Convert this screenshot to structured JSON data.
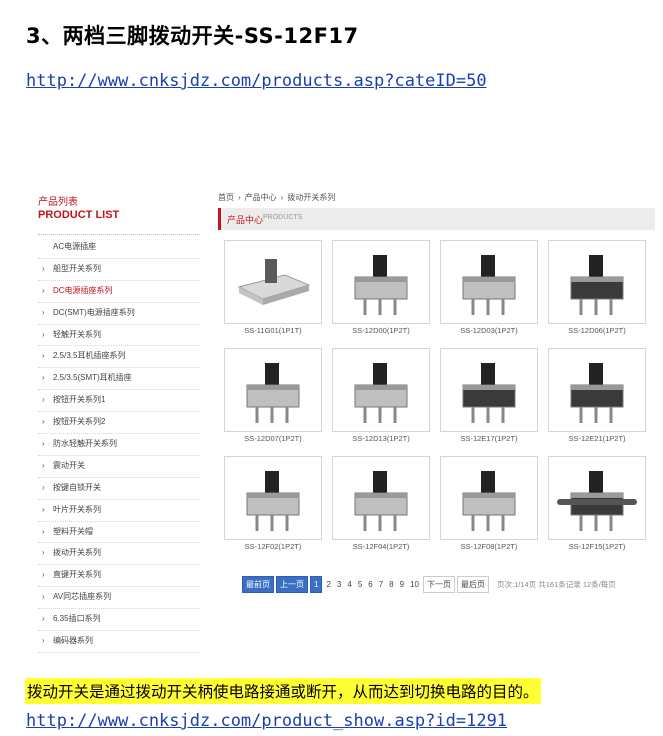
{
  "heading": "3、两档三脚拨动开关-SS-12F17",
  "link_top": "http://www.cnksjdz.com/products.asp?cateID=50",
  "link_bottom": "http://www.cnksjdz.com/product_show.asp?id=1291",
  "note": "拨动开关是通过拨动开关柄使电路接通或断开，从而达到切换电路的目的。",
  "sidebar": {
    "title_cn": "产品列表",
    "title_en": "PRODUCT LIST",
    "items": [
      {
        "label": "AC电源插座",
        "arrow": ""
      },
      {
        "label": "船型开关系列",
        "arrow": "›"
      },
      {
        "label": "DC电源插座系列",
        "arrow": "›",
        "active": true
      },
      {
        "label": "DC(SMT)电源插座系列",
        "arrow": "›"
      },
      {
        "label": "轻触开关系列",
        "arrow": "›"
      },
      {
        "label": "2.5/3.5耳机插座系列",
        "arrow": "›"
      },
      {
        "label": "2.5/3.5(SMT)耳机插座",
        "arrow": "›"
      },
      {
        "label": "按钮开关系列1",
        "arrow": "›"
      },
      {
        "label": "按钮开关系列2",
        "arrow": "›"
      },
      {
        "label": "防水轻触开关系列",
        "arrow": "›"
      },
      {
        "label": "震动开关",
        "arrow": "›"
      },
      {
        "label": "按键自锁开关",
        "arrow": "›"
      },
      {
        "label": "叶片开关系列",
        "arrow": "›"
      },
      {
        "label": "塑料开关帽",
        "arrow": "›"
      },
      {
        "label": "拨动开关系列",
        "arrow": "›"
      },
      {
        "label": "直键开关系列",
        "arrow": "›"
      },
      {
        "label": "AV同芯插座系列",
        "arrow": "›"
      },
      {
        "label": "6.35插口系列",
        "arrow": "›"
      },
      {
        "label": "编码器系列",
        "arrow": "›"
      }
    ]
  },
  "breadcrumb": [
    "首页",
    "›",
    "产品中心",
    "›",
    "拨动开关系列"
  ],
  "section_bar": {
    "cn": "产品中心",
    "en": "PRODUCTS"
  },
  "products": [
    {
      "name": "SS-11G01(1P1T)"
    },
    {
      "name": "SS-12D00(1P2T)"
    },
    {
      "name": "SS-12D03(1P2T)"
    },
    {
      "name": "SS-12D06(1P2T)"
    },
    {
      "name": "SS-12D07(1P2T)"
    },
    {
      "name": "SS-12D13(1P2T)"
    },
    {
      "name": "SS-12E17(1P2T)"
    },
    {
      "name": "SS-12E21(1P2T)"
    },
    {
      "name": "SS-12F02(1P2T)"
    },
    {
      "name": "SS-12F04(1P2T)"
    },
    {
      "name": "SS-12F08(1P2T)"
    },
    {
      "name": "SS-12F15(1P2T)"
    }
  ],
  "pager": {
    "first": "最前页",
    "prev": "上一页",
    "pages": [
      "1",
      "2",
      "3",
      "4",
      "5",
      "6",
      "7",
      "8",
      "9",
      "10"
    ],
    "current": "1",
    "next": "下一页",
    "last": "最后页",
    "info": "页次:1/14页 共161条记录 12条/每页"
  }
}
